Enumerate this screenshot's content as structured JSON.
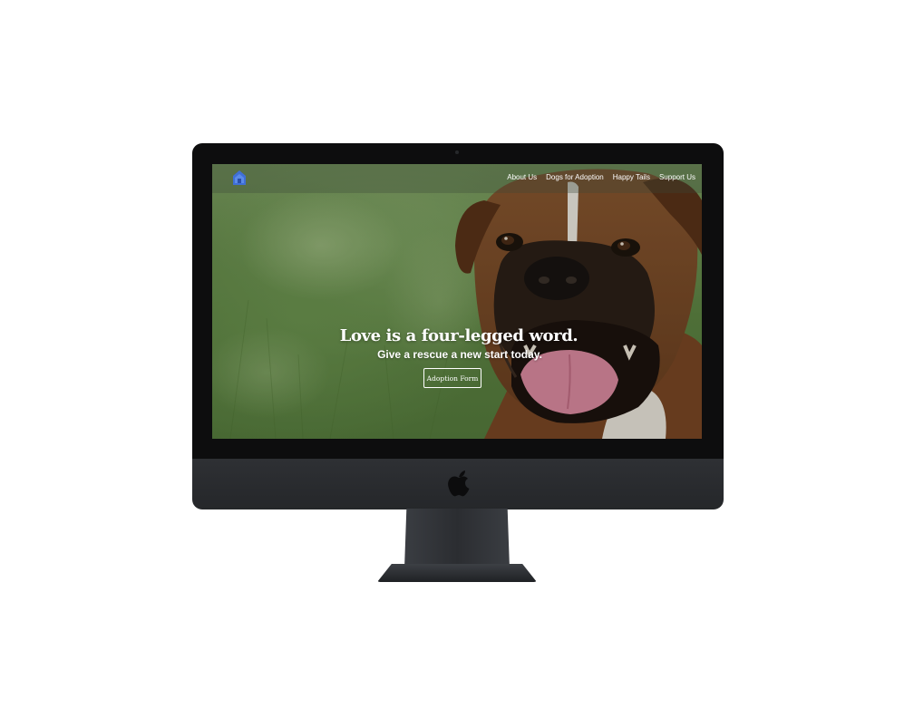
{
  "nav": {
    "items": [
      {
        "label": "About Us"
      },
      {
        "label": "Dogs for Adoption"
      },
      {
        "label": "Happy Tails"
      },
      {
        "label": "Support Us"
      }
    ]
  },
  "hero": {
    "title": "Love is a four-legged word.",
    "subtitle": "Give a rescue a new start today.",
    "button_label": "Adoption Form"
  },
  "icons": {
    "site_logo": "house-logo-icon",
    "device_logo": "apple-logo-icon"
  },
  "colors": {
    "logo_blue": "#3f6fd6",
    "device_body": "#2a2c30",
    "bezel": "#0d0d0e"
  }
}
